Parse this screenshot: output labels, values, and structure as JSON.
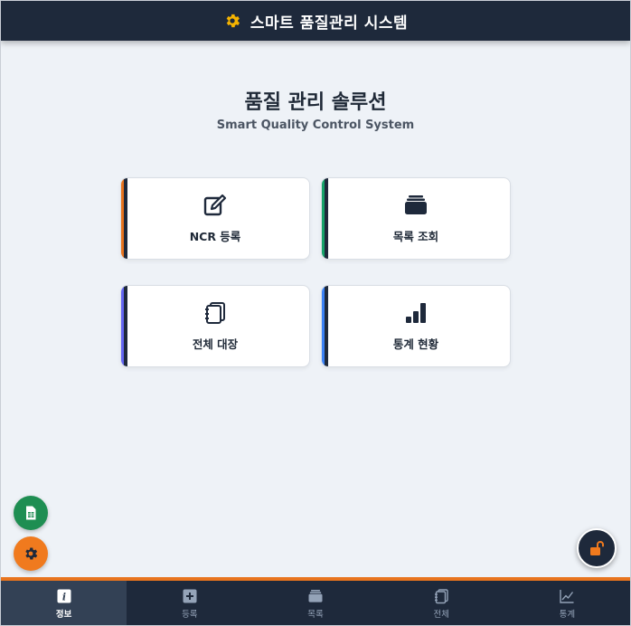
{
  "header": {
    "title": "스마트 품질관리 시스템",
    "icon": "gear-icon",
    "icon_color": "#f5b301",
    "bg": "#1e293b"
  },
  "hero": {
    "title": "품질 관리 솔루션",
    "subtitle": "Smart Quality Control System"
  },
  "cards": [
    {
      "label": "NCR 등록",
      "icon": "edit-icon",
      "accent": "#e8741e"
    },
    {
      "label": "목록 조회",
      "icon": "folder-icon",
      "accent": "#16a36a"
    },
    {
      "label": "전체 대장",
      "icon": "notebook-icon",
      "accent": "#6366f1"
    },
    {
      "label": "통계 현황",
      "icon": "bar-chart-icon",
      "accent": "#3b82f6"
    }
  ],
  "fabs": [
    {
      "name": "spreadsheet-fab",
      "icon": "spreadsheet-icon",
      "color": "#1e8e52"
    },
    {
      "name": "settings-fab",
      "icon": "gear-icon",
      "color": "#f07a1e"
    },
    {
      "name": "lock-fab",
      "icon": "unlock-icon",
      "color": "#1e293b"
    }
  ],
  "nav": [
    {
      "label": "정보",
      "icon": "info-icon",
      "active": true
    },
    {
      "label": "등록",
      "icon": "plus-icon",
      "active": false
    },
    {
      "label": "목록",
      "icon": "folder-icon",
      "active": false
    },
    {
      "label": "전체",
      "icon": "notebook-icon",
      "active": false
    },
    {
      "label": "통계",
      "icon": "line-chart-icon",
      "active": false
    }
  ]
}
